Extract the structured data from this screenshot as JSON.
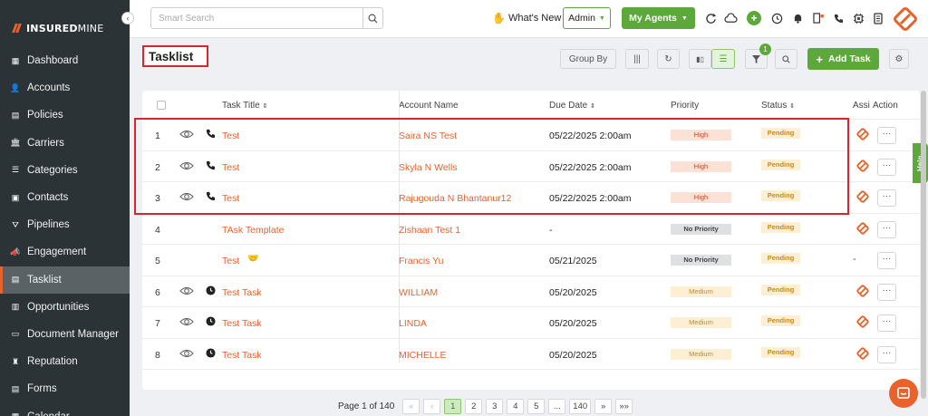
{
  "brand": {
    "name_bold": "INSURED",
    "name_rest": "MINE",
    "accent": "#e8632b"
  },
  "sidebar": {
    "items": [
      {
        "label": "Dashboard",
        "icon": "dashboard-icon"
      },
      {
        "label": "Accounts",
        "icon": "accounts-icon"
      },
      {
        "label": "Policies",
        "icon": "policies-icon"
      },
      {
        "label": "Carriers",
        "icon": "carriers-icon"
      },
      {
        "label": "Categories",
        "icon": "categories-icon"
      },
      {
        "label": "Contacts",
        "icon": "contacts-icon"
      },
      {
        "label": "Pipelines",
        "icon": "pipelines-icon"
      },
      {
        "label": "Engagement",
        "icon": "engagement-icon"
      },
      {
        "label": "Tasklist",
        "icon": "tasklist-icon",
        "active": true
      },
      {
        "label": "Opportunities",
        "icon": "opportunities-icon"
      },
      {
        "label": "Document Manager",
        "icon": "folder-icon"
      },
      {
        "label": "Reputation",
        "icon": "reputation-icon"
      },
      {
        "label": "Forms",
        "icon": "forms-icon"
      },
      {
        "label": "Calendar",
        "icon": "calendar-icon"
      }
    ]
  },
  "header": {
    "search_placeholder": "Smart Search",
    "whats_new": "What's New",
    "role": "Admin",
    "agents_label": "My Agents"
  },
  "page": {
    "title": "Tasklist",
    "group_by": "Group By",
    "filter_count": "1",
    "add_task": "Add Task"
  },
  "table": {
    "columns": {
      "title": "Task Title",
      "account": "Account Name",
      "due": "Due Date",
      "priority": "Priority",
      "status": "Status",
      "assignee": "Assi",
      "action": "Action"
    },
    "rows": [
      {
        "num": "1",
        "title": "Test",
        "account": "Saira NS Test",
        "due": "05/22/2025  2:00am",
        "priority": "High",
        "status": "Pending",
        "view": true,
        "type": "phone",
        "assigned": true
      },
      {
        "num": "2",
        "title": "Test",
        "account": "Skyla N Wells",
        "due": "05/22/2025  2:00am",
        "priority": "High",
        "status": "Pending",
        "view": true,
        "type": "phone",
        "assigned": true
      },
      {
        "num": "3",
        "title": "Test",
        "account": "Rajugouda N Bhantanur12",
        "due": "05/22/2025  2:00am",
        "priority": "High",
        "status": "Pending",
        "view": true,
        "type": "phone",
        "assigned": true
      },
      {
        "num": "4",
        "title": "TAsk Template",
        "account": "Zishaan Test 1",
        "due": "-",
        "priority": "No Priority",
        "status": "Pending",
        "view": false,
        "type": "",
        "assigned": true
      },
      {
        "num": "5",
        "title": "Test",
        "account": "Francis Yu",
        "due": "05/21/2025",
        "priority": "No Priority",
        "status": "Pending",
        "view": false,
        "type": "",
        "assigned": false,
        "assignee_text": "-"
      },
      {
        "num": "6",
        "title": "Test Task",
        "account": "WILLIAM",
        "due": "05/20/2025",
        "priority": "Medium",
        "status": "Pending",
        "view": true,
        "type": "clock",
        "assigned": true
      },
      {
        "num": "7",
        "title": "Test Task",
        "account": "LINDA",
        "due": "05/20/2025",
        "priority": "Medium",
        "status": "Pending",
        "view": true,
        "type": "clock",
        "assigned": true
      },
      {
        "num": "8",
        "title": "Test Task",
        "account": "MICHELLE",
        "due": "05/20/2025",
        "priority": "Medium",
        "status": "Pending",
        "view": true,
        "type": "clock",
        "assigned": true
      }
    ],
    "action_label": "···"
  },
  "pagination": {
    "label": "Page 1 of 140",
    "first": "«",
    "prev": "‹",
    "pages": [
      "1",
      "2",
      "3",
      "4",
      "5",
      "...",
      "140"
    ],
    "current": "1",
    "next": "»",
    "last": "»»"
  },
  "help_label": "Help"
}
